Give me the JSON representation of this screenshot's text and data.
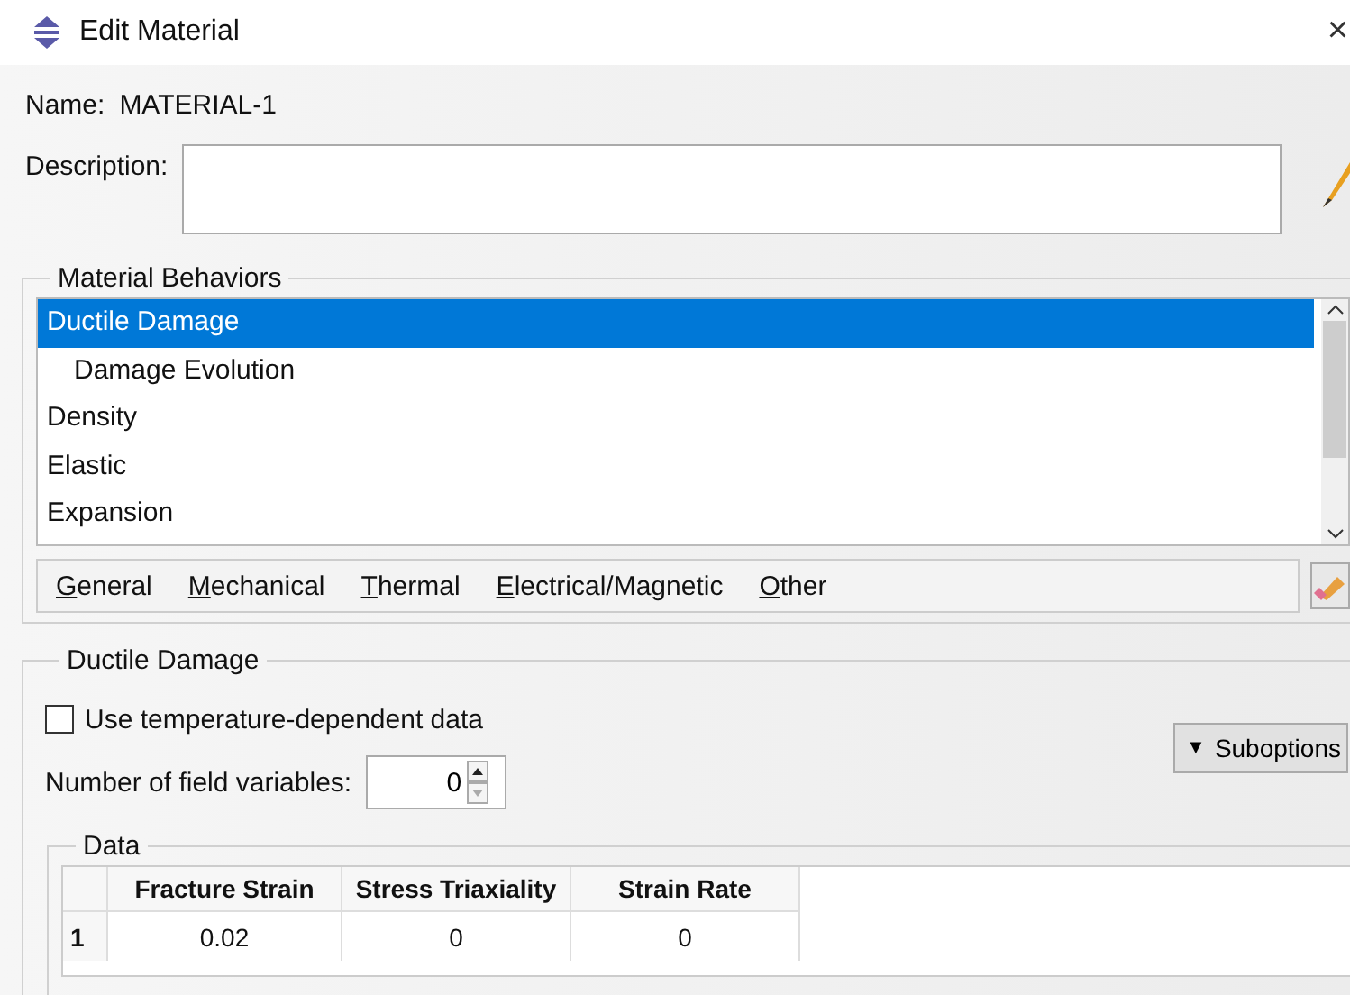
{
  "window": {
    "title": "Edit Material",
    "close": "×"
  },
  "name": {
    "label": "Name:",
    "value": "MATERIAL-1"
  },
  "description": {
    "label": "Description:"
  },
  "behaviors": {
    "title": "Material Behaviors",
    "items": [
      {
        "label": "Ductile Damage",
        "selected": true,
        "children": [
          {
            "label": "Damage Evolution",
            "selected": false
          }
        ]
      },
      {
        "label": "Density",
        "selected": false
      },
      {
        "label": "Elastic",
        "selected": false
      },
      {
        "label": "Expansion",
        "selected": false
      }
    ],
    "menus": [
      "General",
      "Mechanical",
      "Thermal",
      "Electrical/Magnetic",
      "Other"
    ]
  },
  "editor": {
    "title": "Ductile Damage",
    "temperature_dependent": {
      "label": "Use temperature-dependent data",
      "checked": false
    },
    "suboptions": {
      "label": "Suboptions",
      "caret": "▼"
    },
    "field_variables": {
      "label": "Number of field variables:",
      "value": "0"
    },
    "data": {
      "title": "Data",
      "columns": [
        "Fracture Strain",
        "Stress Triaxiality",
        "Strain Rate"
      ],
      "rows": [
        {
          "number": "1",
          "cells": [
            "0.02",
            "0",
            "0"
          ]
        }
      ]
    }
  }
}
